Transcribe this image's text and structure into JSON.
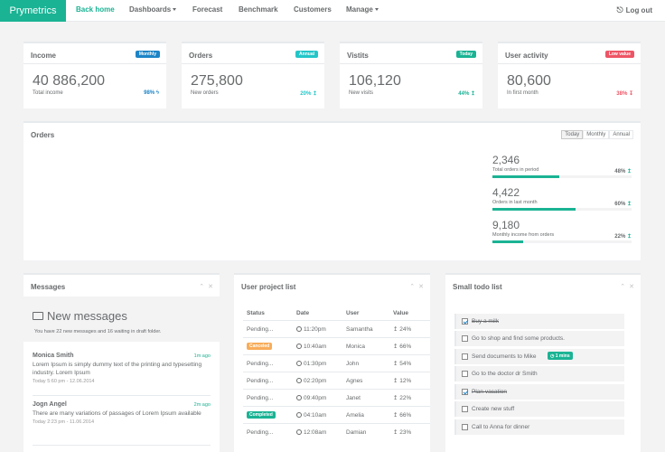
{
  "nav": {
    "brand": "Prymetrics",
    "items": [
      {
        "label": "Back home"
      },
      {
        "label": "Dashboards"
      },
      {
        "label": "Forecast"
      },
      {
        "label": "Benchmark"
      },
      {
        "label": "Customers"
      },
      {
        "label": "Manage"
      }
    ],
    "logout": "Log out",
    "logout_icon": "⎋"
  },
  "stats": [
    {
      "title": "Income",
      "badge": "Monthly",
      "badge_color": "#1c84c6",
      "value": "40 886,200",
      "sub": "Total income",
      "pct": "98%",
      "arrow": "ϟ",
      "pct_color": "#1c84c6"
    },
    {
      "title": "Orders",
      "badge": "Annual",
      "badge_color": "#23c6c8",
      "value": "275,800",
      "sub": "New orders",
      "pct": "20%",
      "arrow": "↥",
      "pct_color": "#23c6c8"
    },
    {
      "title": "Vistits",
      "badge": "Today",
      "badge_color": "#1ab394",
      "value": "106,120",
      "sub": "New visits",
      "pct": "44%",
      "arrow": "↥",
      "pct_color": "#1ab394"
    },
    {
      "title": "User activity",
      "badge": "Low value",
      "badge_color": "#ed5565",
      "value": "80,600",
      "sub": "In first month",
      "pct": "38%",
      "arrow": "↧",
      "pct_color": "#ed5565"
    }
  ],
  "orders": {
    "title": "Orders",
    "ranges": [
      "Today",
      "Monthly",
      "Annual"
    ],
    "stats": [
      {
        "value": "2,346",
        "label": "Total orders in period",
        "pct": "48%",
        "arrow": "↥",
        "progress": 0.48
      },
      {
        "value": "4,422",
        "label": "Orders in last month",
        "pct": "60%",
        "arrow": "↥",
        "progress": 0.6
      },
      {
        "value": "9,180",
        "label": "Monthly income from orders",
        "pct": "22%",
        "arrow": "↥",
        "progress": 0.22
      }
    ]
  },
  "messages": {
    "title": "Messages",
    "collapse_icon": "⌃",
    "close_icon": "✕",
    "head_title": "New messages",
    "head_desc": "You have 22 new messages and 16 waiting in draft folder.",
    "items": [
      {
        "name": "Monica Smith",
        "ago": "1m ago",
        "text": "Lorem Ipsum is simply dummy text of the printing and typesetting industry. Lorem Ipsum",
        "date": "Today 5:60 pm - 12.06.2014"
      },
      {
        "name": "Jogn Angel",
        "ago": "2m ago",
        "text": "There are many variations of passages of Lorem Ipsum available",
        "date": "Today 2:23 pm - 11.06.2014"
      }
    ]
  },
  "projects": {
    "title": "User project list",
    "columns": [
      "Status",
      "Date",
      "User",
      "Value"
    ],
    "rows": [
      {
        "status": "Pending...",
        "badge": false,
        "time": "11:20pm",
        "user": "Samantha",
        "value": "24%"
      },
      {
        "status": "Canceled",
        "badge": true,
        "badge_color": "#f8ac59",
        "time": "10:40am",
        "user": "Monica",
        "value": "66%"
      },
      {
        "status": "Pending...",
        "badge": false,
        "time": "01:30pm",
        "user": "John",
        "value": "54%"
      },
      {
        "status": "Pending...",
        "badge": false,
        "time": "02:20pm",
        "user": "Agnes",
        "value": "12%"
      },
      {
        "status": "Pending...",
        "badge": false,
        "time": "09:40pm",
        "user": "Janet",
        "value": "22%"
      },
      {
        "status": "Completed",
        "badge": true,
        "badge_color": "#1ab394",
        "time": "04:10am",
        "user": "Amelia",
        "value": "66%"
      },
      {
        "status": "Pending...",
        "badge": false,
        "time": "12:08am",
        "user": "Damian",
        "value": "23%"
      }
    ]
  },
  "todo": {
    "title": "Small todo list",
    "items": [
      {
        "text": "Buy a milk",
        "done": true
      },
      {
        "text": "Go to shop and find some products.",
        "done": false
      },
      {
        "text": "Send documents to Mike",
        "done": false,
        "badge": "1 mins"
      },
      {
        "text": "Go to the doctor dr Smith",
        "done": false
      },
      {
        "text": "Plan vacation",
        "done": true
      },
      {
        "text": "Create new stuff",
        "done": false
      },
      {
        "text": "Call to Anna for dinner",
        "done": false
      }
    ]
  }
}
